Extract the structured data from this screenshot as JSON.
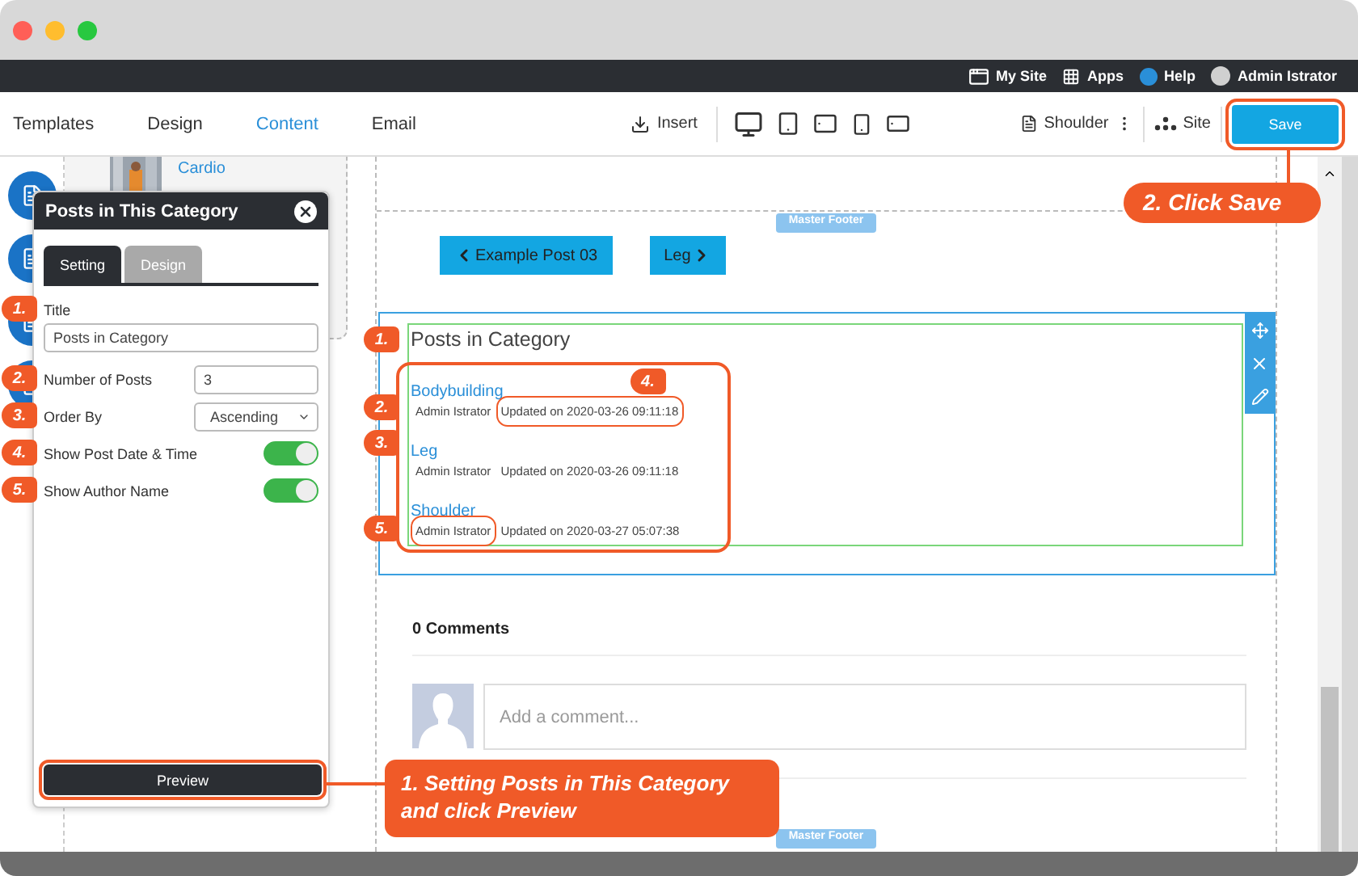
{
  "top_bar": {
    "items": [
      {
        "kind": "site",
        "label": "My Site"
      },
      {
        "kind": "apps",
        "label": "Apps"
      },
      {
        "kind": "help",
        "label": "Help"
      },
      {
        "kind": "user",
        "label": "Admin Istrator"
      }
    ]
  },
  "toolbar": {
    "tabs": [
      {
        "label": "Templates",
        "selected": false
      },
      {
        "label": "Design",
        "selected": false
      },
      {
        "label": "Content",
        "selected": true
      },
      {
        "label": "Email",
        "selected": false
      }
    ],
    "insert": "Insert",
    "page": "Shoulder",
    "site": "Site",
    "save": {
      "label": "Save",
      "circled": true
    }
  },
  "sidebar_card": {
    "link": "Cardio"
  },
  "panel": {
    "title": "Posts in This Category",
    "tabs": [
      {
        "label": "Setting",
        "selected": true
      },
      {
        "label": "Design",
        "selected": false
      }
    ],
    "fields": [
      {
        "kind": "text",
        "badge": "1.",
        "label": "Title",
        "value": "Posts in Category"
      },
      {
        "kind": "number",
        "badge": "2.",
        "label": "Number of Posts",
        "value": "3"
      },
      {
        "kind": "select",
        "badge": "3.",
        "label": "Order By",
        "value": "Ascending"
      },
      {
        "kind": "toggle",
        "badge": "4.",
        "label": "Show Post Date & Time",
        "on": true
      },
      {
        "kind": "toggle",
        "badge": "5.",
        "label": "Show Author Name",
        "on": true
      }
    ],
    "preview": {
      "label": "Preview",
      "circled": true
    }
  },
  "canvas": {
    "header_tag": "Master Footer",
    "nav": [
      {
        "kind": "prev",
        "label": "Example Post 03"
      },
      {
        "kind": "next",
        "label": "Leg"
      }
    ],
    "widget": {
      "title": "Posts in Category",
      "title_badge": "1.",
      "posts_circled": true,
      "posts": [
        {
          "title": "Bodybuilding",
          "meta_badge": "2.",
          "author": "Admin Istrator",
          "updated": "Updated on 2020-03-26 09:11:18",
          "updated_badge": "4.",
          "updated_circled": true,
          "author_circled": false
        },
        {
          "title": "Leg",
          "title_badge": "3.",
          "author": "Admin Istrator",
          "updated": "Updated on 2020-03-26 09:11:18",
          "updated_circled": false,
          "author_circled": false
        },
        {
          "title": "Shoulder",
          "author": "Admin Istrator",
          "author_badge": "5.",
          "updated": "Updated on 2020-03-27 05:07:38",
          "updated_circled": false,
          "author_circled": true
        }
      ]
    },
    "comments": {
      "count": "0 Comments",
      "placeholder": "Add a comment..."
    },
    "footer_tag": "Master Footer"
  },
  "callouts": [
    {
      "text": "1. Setting Posts in This Category and click Preview"
    },
    {
      "text": "2. Click Save"
    }
  ]
}
